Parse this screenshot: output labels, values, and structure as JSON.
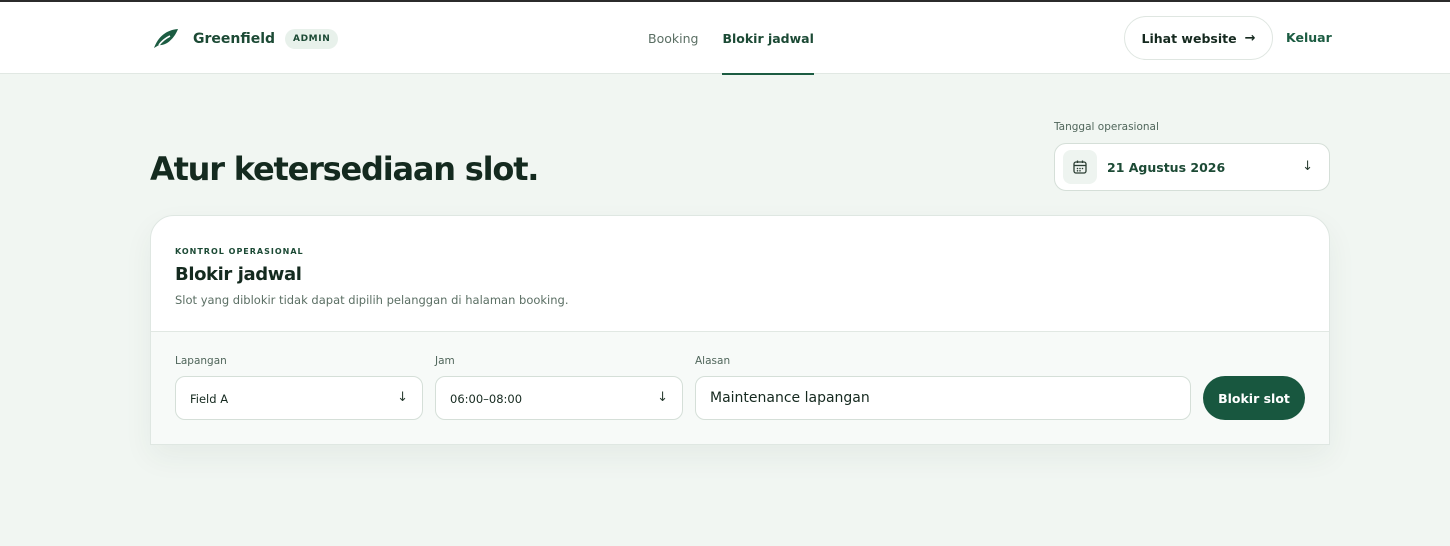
{
  "header": {
    "brand_name": "Greenfield",
    "badge": "ADMIN",
    "logo_icon": "leaf-icon",
    "nav": [
      {
        "label": "Booking",
        "active": false
      },
      {
        "label": "Blokir jadwal",
        "active": true
      }
    ],
    "website_button": "Lihat website",
    "website_icon": "arrow-right-icon",
    "logout": "Keluar"
  },
  "page": {
    "title": "Atur ketersediaan slot."
  },
  "date_picker": {
    "label": "Tanggal operasional",
    "value": "21 Agustus 2026",
    "icon": "calendar-icon"
  },
  "card": {
    "eyebrow": "KONTROL OPERASIONAL",
    "title": "Blokir jadwal",
    "description": "Slot yang diblokir tidak dapat dipilih pelanggan di halaman booking.",
    "form": {
      "field_label": "Lapangan",
      "field_value": "Field A",
      "time_label": "Jam",
      "time_value": "06:00–08:00",
      "reason_label": "Alasan",
      "reason_value": "Maintenance lapangan",
      "submit": "Blokir slot"
    }
  },
  "colors": {
    "accent": "#18573f",
    "background": "#f1f6f2",
    "text": "#142a1f"
  }
}
